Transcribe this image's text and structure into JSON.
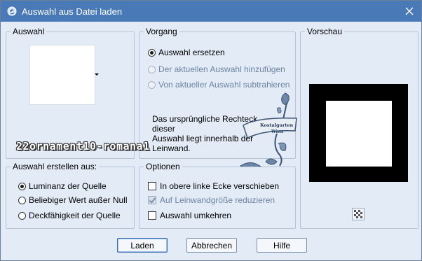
{
  "window": {
    "title": "Auswahl aus Datei laden",
    "icon": "app-icon",
    "close_icon": "close-icon"
  },
  "groups": {
    "auswahl": "Auswahl",
    "vorgang": "Vorgang",
    "vorschau": "Vorschau",
    "erstellen": "Auswahl erstellen aus:",
    "optionen": "Optionen"
  },
  "vorgang": {
    "options": [
      {
        "label": "Auswahl ersetzen",
        "checked": true,
        "enabled": true
      },
      {
        "label": "Der aktuellen Auswahl hinzufügen",
        "checked": false,
        "enabled": false
      },
      {
        "label": "Von aktueller Auswahl subtrahieren",
        "checked": false,
        "enabled": false
      }
    ]
  },
  "note": {
    "line1": "Das ursprüngliche Rechteck dieser",
    "line2": "Auswahl liegt innerhalb der",
    "line3": "Leinwand."
  },
  "watermark": {
    "text": "22ornament10-romana1",
    "ornament_text_1": "Kostalgarten",
    "ornament_text_2": "Wien"
  },
  "erstellen": {
    "options": [
      {
        "label": "Luminanz der Quelle",
        "checked": true
      },
      {
        "label": "Beliebiger Wert außer Null",
        "checked": false
      },
      {
        "label": "Deckfähigkeit der Quelle",
        "checked": false
      }
    ]
  },
  "optionen": {
    "options": [
      {
        "label": "In obere linke Ecke verschieben",
        "checked": false,
        "enabled": true
      },
      {
        "label": "Auf Leinwandgröße reduzieren",
        "checked": true,
        "enabled": false
      },
      {
        "label": "Auswahl umkehren",
        "checked": false,
        "enabled": true
      }
    ]
  },
  "buttons": {
    "load": "Laden",
    "cancel": "Abbrechen",
    "help": "Hilfe"
  },
  "colors": {
    "titlebar": "#4a79b8",
    "dialog_bg": "#e3ebf6",
    "disabled_text": "#6d84a3"
  }
}
